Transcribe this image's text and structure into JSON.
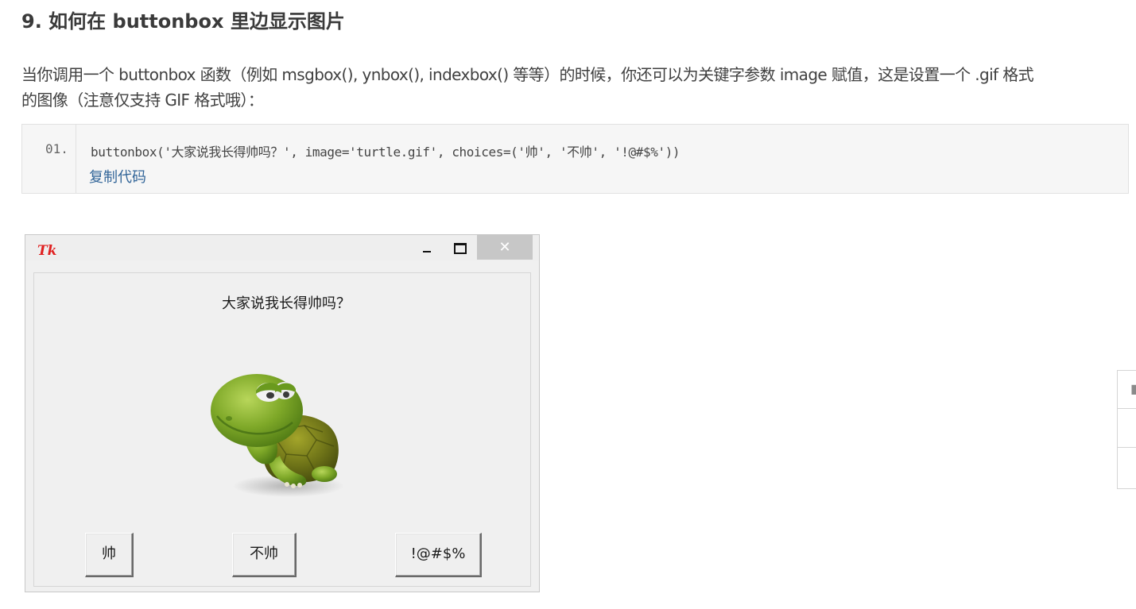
{
  "article": {
    "heading": "9. 如何在 buttonbox 里边显示图片",
    "paragraph_line1": "当你调用一个 buttonbox 函数（例如 msgbox(), ynbox(), indexbox() 等等）的时候，你还可以为关键字参数 image 赋值，这是设置一个 .gif 格式",
    "paragraph_line2": "的图像（注意仅支持 GIF 格式哦）："
  },
  "code_block": {
    "line_number": "01.",
    "code": "buttonbox('大家说我长得帅吗？', image='turtle.gif', choices=('帅', '不帅', '!@#$%'))",
    "copy_label": "复制代码"
  },
  "tk_window": {
    "icon_text": "Tk",
    "close_symbol": "✕",
    "message": "大家说我长得帅吗？",
    "image_icon": "turtle-image",
    "buttons": [
      "帅",
      "不帅",
      "!@#$%"
    ]
  },
  "side_tools": {
    "icons": [
      "comment-icon",
      "share-icon",
      "menu-icon"
    ]
  }
}
